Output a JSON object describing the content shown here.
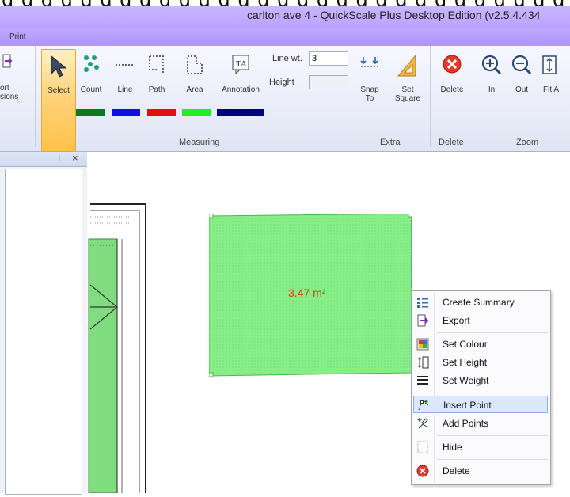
{
  "window": {
    "title": "carlton ave 4 - QuickScale Plus Desktop Edition (v2.5.4.434"
  },
  "menubar": {
    "print_tab": "Print"
  },
  "ribbon": {
    "left_partial_top": "ort",
    "left_partial_bottom": "sions",
    "buttons": {
      "select": "Select",
      "count": "Count",
      "line": "Line",
      "path": "Path",
      "area": "Area",
      "annotation": "Annotation",
      "snap_line1": "Snap",
      "snap_line2": "To",
      "setsq_line1": "Set",
      "setsq_line2": "Square",
      "delete": "Delete",
      "zoom_in": "In",
      "zoom_out": "Out",
      "fit": "Fit A"
    },
    "fields": {
      "line_wt_label": "Line wt.",
      "line_wt_value": "3",
      "height_label": "Height",
      "height_value": ""
    },
    "groups": {
      "measuring": "Measuring",
      "extra": "Extra",
      "delete": "Delete",
      "zoom": "Zoom"
    },
    "swatch_colors": {
      "count": "#0a7a1a",
      "line": "#1010e0",
      "path": "#e01010",
      "area": "#22ee22",
      "annotation": "#000080"
    }
  },
  "panel": {
    "pin": "ᵖ",
    "close": "×"
  },
  "canvas": {
    "area_label": "3.47 m²",
    "area_fill": "#88ee88"
  },
  "context_menu": {
    "items": [
      {
        "label": "Create Summary",
        "icon": "summary-icon"
      },
      {
        "label": "Export",
        "icon": "export-icon"
      },
      {
        "label": "Set Colour",
        "icon": "palette-icon"
      },
      {
        "label": "Set Height",
        "icon": "height-icon"
      },
      {
        "label": "Set Weight",
        "icon": "weight-icon"
      },
      {
        "label": "Insert Point",
        "icon": "insert-point-icon",
        "highlighted": true
      },
      {
        "label": "Add Points",
        "icon": "add-points-icon"
      },
      {
        "label": "Hide",
        "icon": "hide-icon"
      },
      {
        "label": "Delete",
        "icon": "delete-icon"
      }
    ]
  }
}
